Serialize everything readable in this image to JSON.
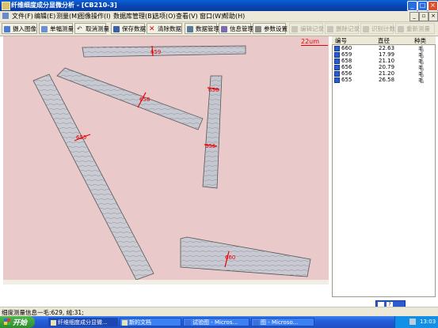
{
  "window": {
    "title": "纤维细度成分显微分析 - [CB210-3]"
  },
  "menu": [
    "文件(F)",
    "编辑(E)",
    "测量(M)",
    "图像操作(I)",
    "数据库管理(B)",
    "选项(O)",
    "查看(V)",
    "窗口(W)",
    "帮助(H)"
  ],
  "toolbar": {
    "insert_image": "摄入图像",
    "single_measure": "单幅测量",
    "cancel_measure": "取消测量",
    "save_data": "保存数据",
    "clear_data": "清除数据",
    "data_manage": "数据管理",
    "info_manage": "信息管理",
    "param_settings": "参数设置",
    "edit_record": "编辑记录",
    "delete_record": "删除记录",
    "identify_count": "识别计数",
    "remeasure": "重新测量"
  },
  "image": {
    "scale_label": "22um",
    "fiber_labels": [
      "659",
      "658",
      "656",
      "656",
      "655",
      "660"
    ]
  },
  "table": {
    "headers": [
      "编号",
      "直径",
      "种类"
    ],
    "rows": [
      {
        "id": "660",
        "diameter": "22.63",
        "type": "毛"
      },
      {
        "id": "659",
        "diameter": "17.99",
        "type": "毛"
      },
      {
        "id": "658",
        "diameter": "21.10",
        "type": "毛"
      },
      {
        "id": "656",
        "diameter": "20.79",
        "type": "毛"
      },
      {
        "id": "656",
        "diameter": "21.20",
        "type": "毛"
      },
      {
        "id": "655",
        "diameter": "26.58",
        "type": "毛"
      }
    ]
  },
  "status": "细度测量信息一毛:629, 绒:31;",
  "taskbar": {
    "start": "开始",
    "tasks": [
      "纤维细度成分显微...",
      "新的文档",
      "试验图 - Micros...",
      "图 - Microso..."
    ],
    "clock": "13:03"
  },
  "colors": {
    "accent": "#0a5fd8",
    "measure_red": "#e00000",
    "image_bg": "#e9c9c9"
  }
}
